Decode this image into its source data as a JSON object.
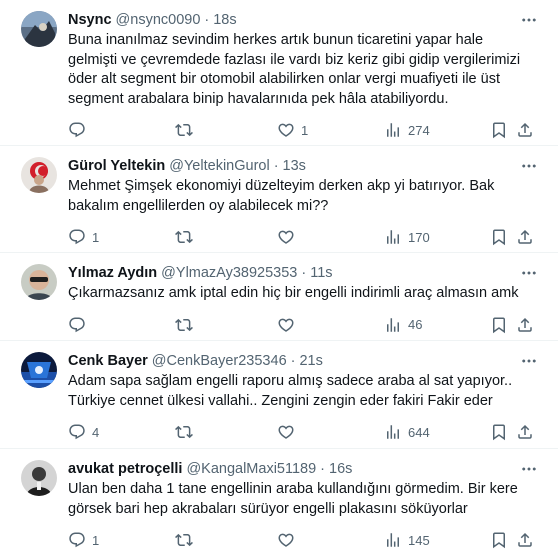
{
  "tweets": [
    {
      "name": "Nsync",
      "handle": "@nsync0090",
      "time": "18s",
      "text": "Buna inanılmaz sevindim herkes artık bunun ticaretini yapar hale gelmişti ve çevremdede fazlası ile vardı biz keriz gibi gidip vergilerimizi öder alt segment bir otomobil alabilirken onlar vergi muafiyeti ile üst segment arabalara binip havalarınıda pek hâla atabiliyordu.",
      "replies": "",
      "retweets": "",
      "likes": "1",
      "views": "274"
    },
    {
      "name": "Gürol Yeltekin",
      "handle": "@YeltekinGurol",
      "time": "13s",
      "text": "Mehmet Şimşek ekonomiyi düzelteyim derken akp yi batırıyor. Bak bakalım engellilerden oy alabilecek mi??",
      "replies": "1",
      "retweets": "",
      "likes": "",
      "views": "170"
    },
    {
      "name": "Yılmaz Aydın",
      "handle": "@YlmazAy38925353",
      "time": "11s",
      "text": "Çıkarmazsanız amk iptal edin hiç bir engelli indirimli araç almasın amk",
      "replies": "",
      "retweets": "",
      "likes": "",
      "views": "46"
    },
    {
      "name": "Cenk Bayer",
      "handle": "@CenkBayer235346",
      "time": "21s",
      "text": "Adam sapa sağlam engelli raporu almış sadece araba al sat yapıyor.. Türkiye cennet ülkesi vallahi.. Zengini zengin eder fakiri Fakir eder",
      "replies": "4",
      "retweets": "",
      "likes": "",
      "views": "644"
    },
    {
      "name": "avukat petroçelli",
      "handle": "@KangalMaxi51189",
      "time": "16s",
      "text": "Ulan ben daha 1 tane engellinin araba kullandığını görmedim. Bir kere görsek bari hep akrabaları sürüyor engelli plakasını söküyorlar",
      "replies": "1",
      "retweets": "",
      "likes": "",
      "views": "145"
    }
  ],
  "icons": {
    "reply": "reply-icon",
    "retweet": "retweet-icon",
    "like": "like-icon",
    "views": "views-icon",
    "bookmark": "bookmark-icon",
    "share": "share-icon",
    "more": "more-icon"
  },
  "colors": {
    "text": "#0f1419",
    "secondary": "#536471",
    "divider": "#eff3f4"
  }
}
